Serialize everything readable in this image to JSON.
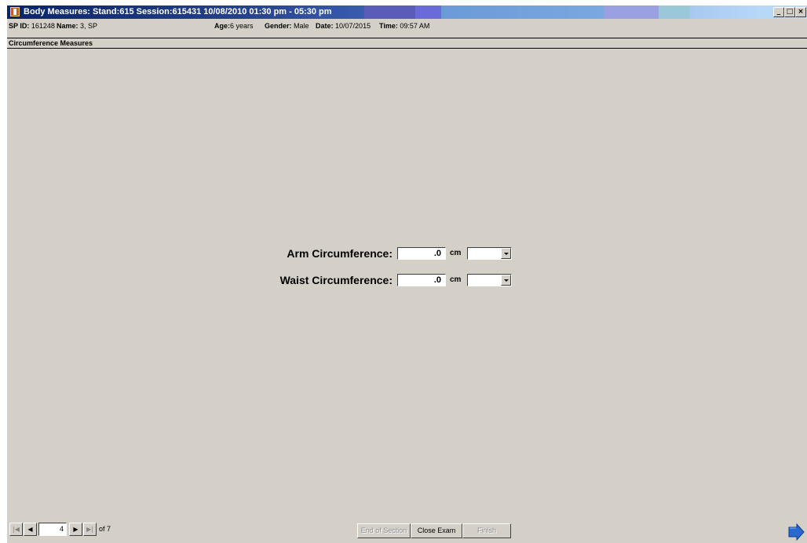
{
  "window": {
    "title": "Body Measures: Stand:615 Session:615431 10/08/2010 01:30 pm - 05:30 pm",
    "controls": {
      "minimize": "_",
      "maximize": "□",
      "close": "×"
    }
  },
  "infobar": {
    "sp_id_label": "SP ID:",
    "sp_id": "161248",
    "name_label": "Name:",
    "name": "3, SP",
    "age_label": "Age:",
    "age": "6 years",
    "gender_label": "Gender:",
    "gender": "Male",
    "date_label": "Date:",
    "date": "10/07/2015",
    "time_label": "Time:",
    "time": "09:57 AM"
  },
  "section": {
    "title": "Circumference Measures"
  },
  "form": {
    "arm": {
      "label": "Arm Circumference:",
      "value": ".0",
      "unit": "cm",
      "select_value": ""
    },
    "waist": {
      "label": "Waist Circumference:",
      "value": ".0",
      "unit": "cm",
      "select_value": ""
    }
  },
  "navigation": {
    "first": "|◀",
    "prev": "◀",
    "next": "▶",
    "last": "▶|",
    "current_page": "4",
    "total_label": "of 7"
  },
  "actions": {
    "end_of_section": "End of Section",
    "close_exam": "Close Exam",
    "finish": "Finish"
  },
  "colors": {
    "background": "#d4d0c8",
    "titlebar_start": "#0a246a",
    "next_arrow": "#2a6ad0"
  }
}
